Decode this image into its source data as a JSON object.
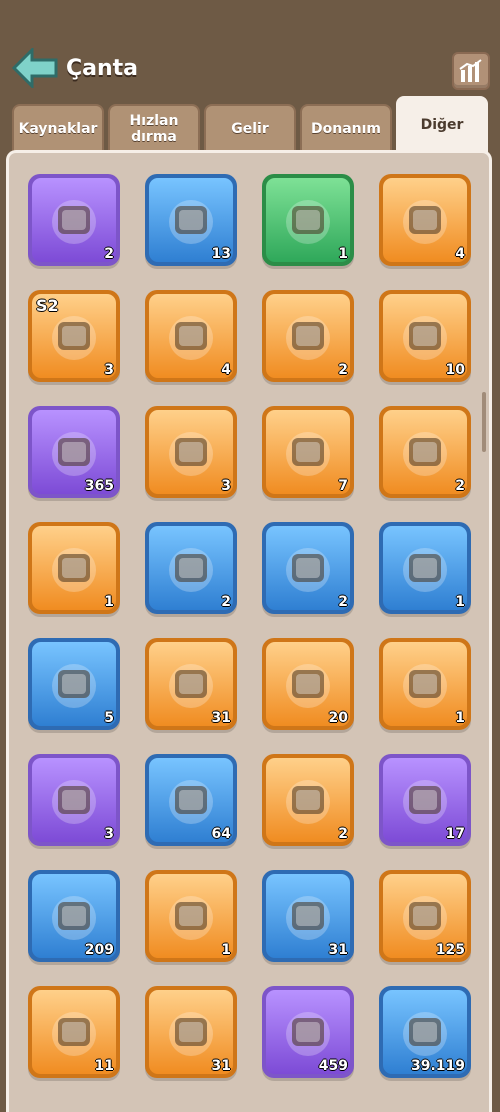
{
  "header": {
    "title": "Çanta"
  },
  "tabs": [
    {
      "label": "Kaynaklar"
    },
    {
      "label": "Hızlan dırma"
    },
    {
      "label": "Gelir"
    },
    {
      "label": "Donanım"
    },
    {
      "label": "Diğer"
    }
  ],
  "items": [
    {
      "icon": "castle-plot-icon",
      "count": "2",
      "rarity": "purple"
    },
    {
      "icon": "banner-plot-icon",
      "count": "13",
      "rarity": "blue"
    },
    {
      "icon": "mystery-plot-icon",
      "count": "1",
      "rarity": "green"
    },
    {
      "icon": "treasure-pile-icon",
      "count": "4",
      "rarity": "orange"
    },
    {
      "icon": "s2-chest-icon",
      "count": "3",
      "rarity": "orange",
      "badge": "S2"
    },
    {
      "icon": "blue-chest-icon",
      "count": "4",
      "rarity": "orange"
    },
    {
      "icon": "red-chest-icon",
      "count": "2",
      "rarity": "orange"
    },
    {
      "icon": "golden-key-icon",
      "count": "10",
      "rarity": "orange"
    },
    {
      "icon": "hex-token-icon",
      "count": "365",
      "rarity": "purple"
    },
    {
      "icon": "purple-ticket-icon",
      "count": "3",
      "rarity": "orange"
    },
    {
      "icon": "exchange-ticket-icon",
      "count": "7",
      "rarity": "orange"
    },
    {
      "icon": "fish-plaque-icon",
      "count": "2",
      "rarity": "orange"
    },
    {
      "icon": "seashell-icon",
      "count": "1",
      "rarity": "orange"
    },
    {
      "icon": "green-potion-icon",
      "count": "2",
      "rarity": "blue"
    },
    {
      "icon": "fishing-lure-icon",
      "count": "2",
      "rarity": "blue"
    },
    {
      "icon": "fishing-rod-icon",
      "count": "1",
      "rarity": "blue"
    },
    {
      "icon": "metal-gauntlet-icon",
      "count": "5",
      "rarity": "blue"
    },
    {
      "icon": "firework-rocket-icon",
      "count": "31",
      "rarity": "orange"
    },
    {
      "icon": "crown-ticket-icon",
      "count": "20",
      "rarity": "orange"
    },
    {
      "icon": "gun-ticket-icon",
      "count": "1",
      "rarity": "orange"
    },
    {
      "icon": "id-card-icon",
      "count": "3",
      "rarity": "purple"
    },
    {
      "icon": "stone-arrowhead-icon",
      "count": "64",
      "rarity": "blue"
    },
    {
      "icon": "lion-emblem-icon",
      "count": "2",
      "rarity": "orange"
    },
    {
      "icon": "green-vial-icon",
      "count": "17",
      "rarity": "purple"
    },
    {
      "icon": "paw-book-icon",
      "count": "209",
      "rarity": "blue"
    },
    {
      "icon": "gold-ore-icon",
      "count": "1",
      "rarity": "orange"
    },
    {
      "icon": "silver-ore-icon",
      "count": "31",
      "rarity": "blue"
    },
    {
      "icon": "diamond-scroll-icon",
      "count": "125",
      "rarity": "orange"
    },
    {
      "icon": "gem-book-icon",
      "count": "11",
      "rarity": "orange"
    },
    {
      "icon": "map-scrolls-icon",
      "count": "31",
      "rarity": "orange"
    },
    {
      "icon": "thread-spool-icon",
      "count": "459",
      "rarity": "purple"
    },
    {
      "icon": "blue-cloth-icon",
      "count": "39.119",
      "rarity": "blue"
    }
  ]
}
